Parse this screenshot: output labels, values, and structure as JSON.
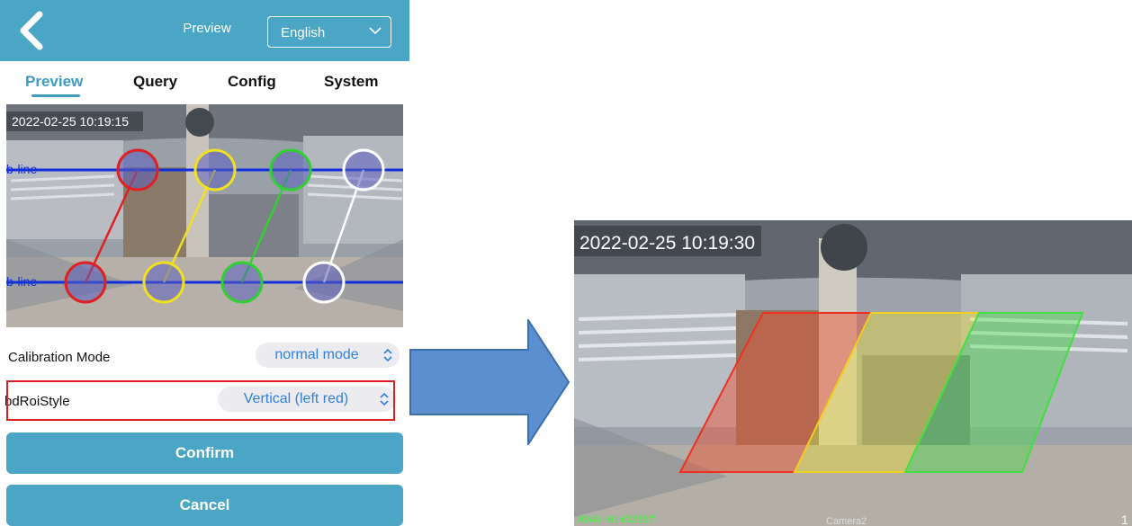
{
  "header": {
    "title": "Preview",
    "language": "English"
  },
  "tabs": [
    {
      "label": "Preview",
      "active": true
    },
    {
      "label": "Query",
      "active": false
    },
    {
      "label": "Config",
      "active": false
    },
    {
      "label": "System",
      "active": false
    }
  ],
  "preview": {
    "timestamp": "2022-02-25 10:19:15",
    "top_line_label": "b-line",
    "bottom_line_label": "b-line"
  },
  "settings": [
    {
      "label": "Calibration Mode",
      "value": "normal mode"
    },
    {
      "label": "bdRoiStyle",
      "value": "Vertical (left red)"
    }
  ],
  "buttons": {
    "confirm": "Confirm",
    "cancel": "Cancel"
  },
  "camera": {
    "timestamp": "2022-02-25 10:19:30",
    "device_id": "ADAS-9143295f",
    "channel": "Camera2",
    "corner_number": "1"
  },
  "colors": {
    "brand": "#4aa6c4",
    "accent": "#3d9bc1",
    "highlight": "#e02020",
    "arrow": "#5b8fcf"
  }
}
